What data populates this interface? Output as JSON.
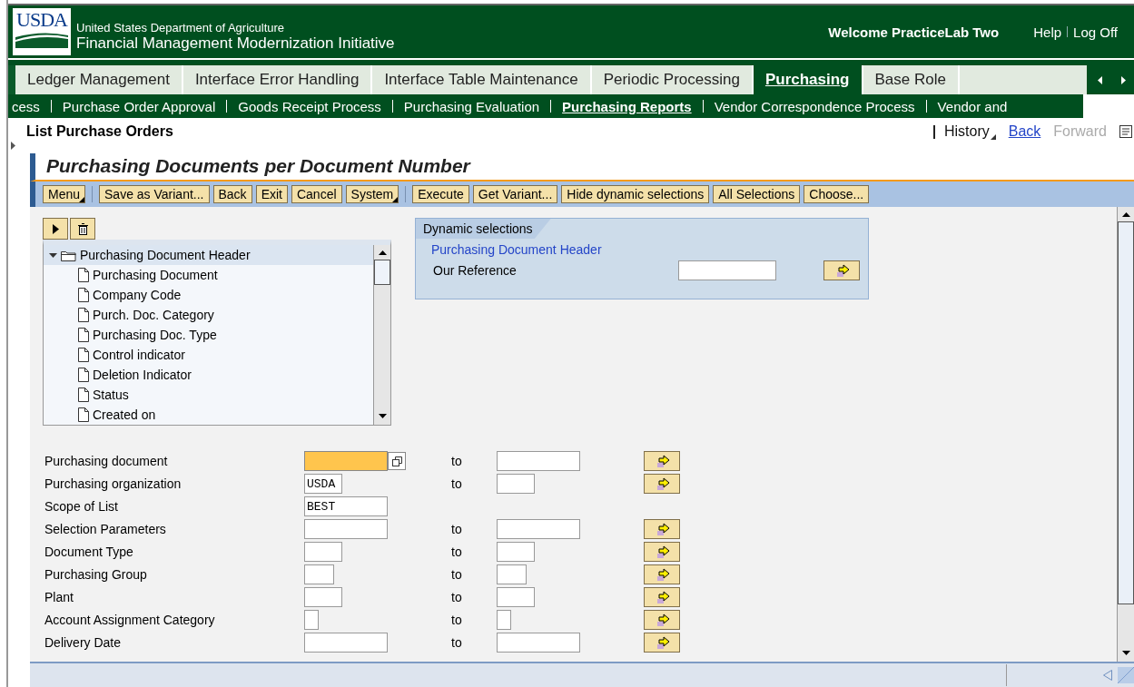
{
  "header": {
    "logo": "USDA",
    "org": "United States Department of Agriculture",
    "title": "Financial Management Modernization Initiative",
    "welcome": "Welcome PracticeLab Two",
    "links": [
      "Help",
      "Log Off"
    ]
  },
  "tabs": [
    {
      "label": "Ledger Management",
      "selected": false
    },
    {
      "label": "Interface Error Handling",
      "selected": false
    },
    {
      "label": "Interface Table Maintenance",
      "selected": false
    },
    {
      "label": "Periodic Processing",
      "selected": false
    },
    {
      "label": "Purchasing",
      "selected": true
    },
    {
      "label": "Base Role",
      "selected": false
    }
  ],
  "subtabs": [
    {
      "label": "cess",
      "selected": false
    },
    {
      "label": "Purchase Order Approval",
      "selected": false
    },
    {
      "label": "Goods Receipt Process",
      "selected": false
    },
    {
      "label": "Purchasing Evaluation",
      "selected": false
    },
    {
      "label": "Purchasing Reports",
      "selected": true
    },
    {
      "label": "Vendor Correspondence Process",
      "selected": false
    },
    {
      "label": "Vendor and",
      "selected": false
    }
  ],
  "page": {
    "title": "List Purchase Orders",
    "history": "History",
    "back": {
      "label": "Back",
      "disabled": false
    },
    "forward": {
      "label": "Forward",
      "disabled": true
    }
  },
  "form_title": "Purchasing Documents per Document Number",
  "toolbar": [
    [
      {
        "label": "Menu",
        "kind": "menu"
      }
    ],
    [
      {
        "label": "Save as Variant...",
        "kind": "plain"
      },
      {
        "label": "Back",
        "kind": "plain"
      },
      {
        "label": "Exit",
        "kind": "plain"
      },
      {
        "label": "Cancel",
        "kind": "plain"
      },
      {
        "label": "System",
        "kind": "menu"
      }
    ],
    [
      {
        "label": "Execute",
        "kind": "plain"
      },
      {
        "label": "Get Variant...",
        "kind": "plain"
      },
      {
        "label": "Hide dynamic selections",
        "kind": "plain"
      },
      {
        "label": "All Selections",
        "kind": "plain"
      },
      {
        "label": "Choose...",
        "kind": "plain"
      }
    ]
  ],
  "tree": {
    "label": "Purchasing Document Header",
    "expanded": true,
    "children": [
      {
        "label": "Purchasing Document"
      },
      {
        "label": "Company Code"
      },
      {
        "label": "Purch. Doc. Category"
      },
      {
        "label": "Purchasing Doc. Type"
      },
      {
        "label": "Control indicator"
      },
      {
        "label": "Deletion Indicator"
      },
      {
        "label": "Status"
      },
      {
        "label": "Created on"
      }
    ]
  },
  "dynamic": {
    "tab": "Dynamic selections",
    "group": "Purchasing Document Header",
    "field": "Our Reference"
  },
  "rows": [
    {
      "label": "Purchasing document",
      "from": {
        "focused": true,
        "value_help": true
      },
      "to": {
        "label": "to"
      },
      "multi": true
    },
    {
      "label": "Purchasing organization",
      "from": {
        "value": "USDA",
        "focused": false,
        "value_help": false
      },
      "to": {
        "label": "to"
      },
      "multi": true
    },
    {
      "label": "Scope of List",
      "from": {
        "value": "BEST",
        "focused": false,
        "value_help": false
      },
      "multi": false
    },
    {
      "label": "Selection Parameters",
      "from": {
        "focused": false,
        "value_help": false
      },
      "to": {
        "label": "to"
      },
      "multi": true
    },
    {
      "label": "Document Type",
      "from": {
        "focused": false,
        "value_help": false
      },
      "to": {
        "label": "to"
      },
      "multi": true
    },
    {
      "label": "Purchasing Group",
      "from": {
        "focused": false,
        "value_help": false
      },
      "to": {
        "label": "to"
      },
      "multi": true
    },
    {
      "label": "Plant",
      "from": {
        "focused": false,
        "value_help": false
      },
      "to": {
        "label": "to"
      },
      "multi": true
    },
    {
      "label": "Account Assignment Category",
      "from": {
        "focused": false,
        "value_help": false
      },
      "to": {
        "label": "to"
      },
      "multi": true
    },
    {
      "label": "Delivery Date",
      "from": {
        "focused": false,
        "value_help": false
      },
      "to": {
        "label": "to"
      },
      "multi": true
    }
  ]
}
